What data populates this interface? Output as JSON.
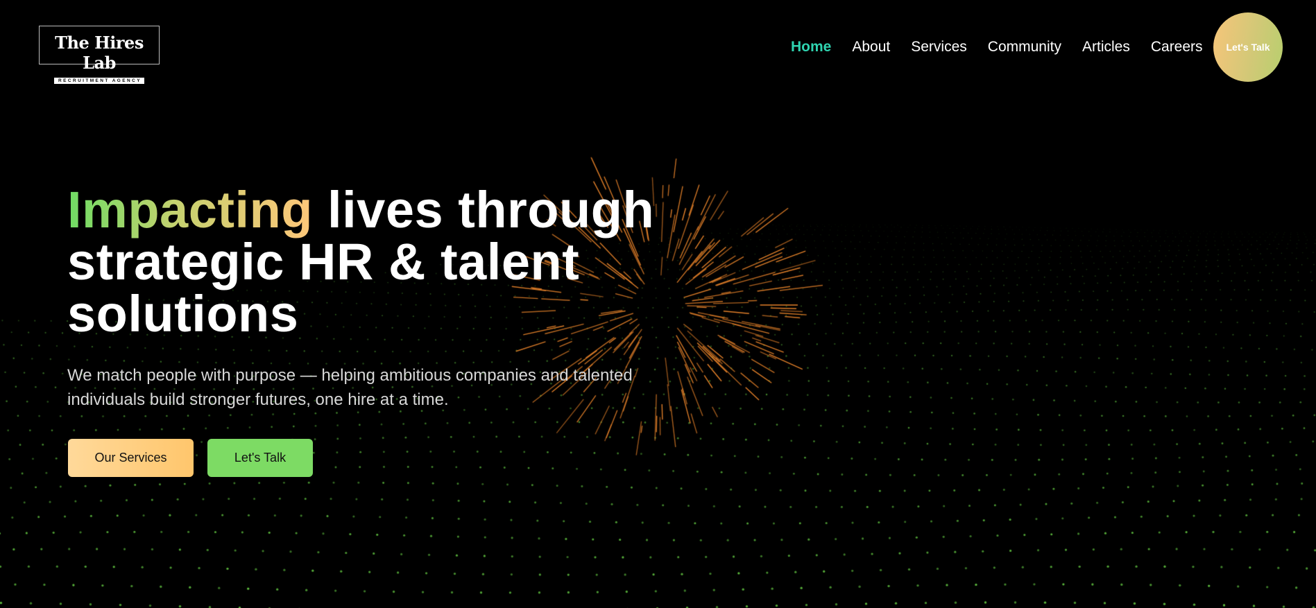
{
  "brand": {
    "name": "The Hires Lab",
    "tagline": "RECRUITMENT AGENCY"
  },
  "nav": {
    "items": [
      "Home",
      "About",
      "Services",
      "Community",
      "Articles",
      "Careers"
    ],
    "active": "Home",
    "cta_label": "Let's Talk"
  },
  "hero": {
    "title_accent": "Impacting",
    "title_rest": " lives through strategic HR & talent solutions",
    "subtitle": "We match people with purpose — helping ambitious companies and talented individuals build stronger futures, one hire at a time.",
    "primary_button": "Our Services",
    "secondary_button": "Let's Talk"
  },
  "colors": {
    "background": "#000000",
    "nav_active": "#2fd3b0",
    "accent_green": "#7ddb64",
    "accent_orange": "#ffc66c",
    "burst": "#e8832a",
    "dots": "#6fe04a"
  },
  "decor": {
    "burst": "orange-line-burst",
    "grid": "green-dot-wave-grid"
  }
}
